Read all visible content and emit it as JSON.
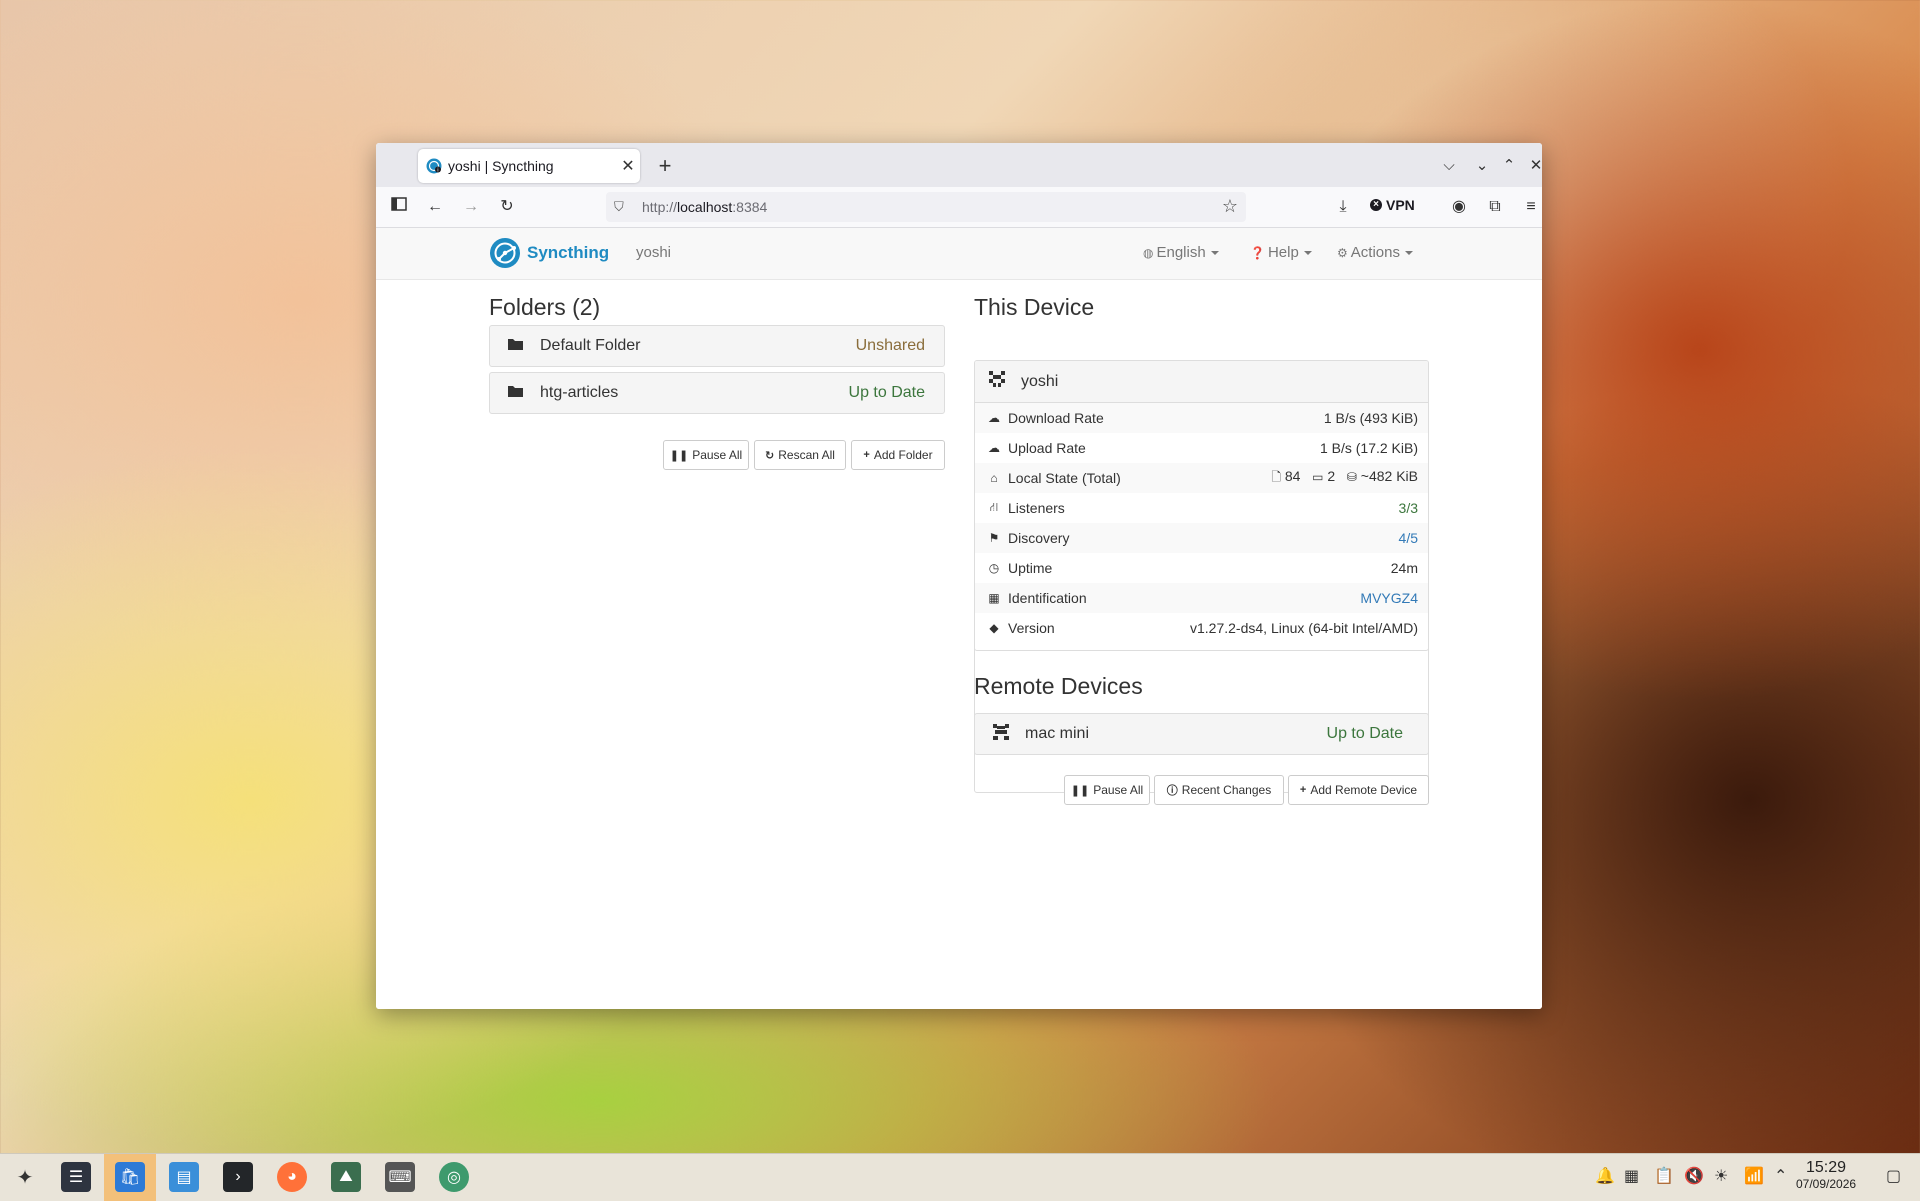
{
  "browser": {
    "tab_title": "yoshi | Syncthing",
    "tab_close": "✕",
    "new_tab": "+",
    "url_scheme": "http://",
    "url_host": "localhost",
    "url_port": ":8384",
    "vpn_label": "VPN"
  },
  "syncthing": {
    "brand": "Syncthing",
    "device_name": "yoshi",
    "menu": {
      "language": "English",
      "help": "Help",
      "actions": "Actions"
    },
    "folders": {
      "heading": "Folders (2)",
      "items": [
        {
          "name": "Default Folder",
          "status": "Unshared"
        },
        {
          "name": "htg-articles",
          "status": "Up to Date"
        }
      ],
      "buttons": {
        "pause_all": "Pause All",
        "rescan_all": "Rescan All",
        "add_folder": "Add Folder"
      }
    },
    "this_device": {
      "heading": "This Device",
      "name": "yoshi",
      "rows": [
        {
          "label": "Download Rate",
          "value": "1 B/s (493 KiB)"
        },
        {
          "label": "Upload Rate",
          "value": "1 B/s (17.2 KiB)"
        },
        {
          "label": "Local State (Total)",
          "files": "84",
          "dirs": "2",
          "size": "~482 KiB"
        },
        {
          "label": "Listeners",
          "value": "3/3"
        },
        {
          "label": "Discovery",
          "value": "4/5"
        },
        {
          "label": "Uptime",
          "value": "24m"
        },
        {
          "label": "Identification",
          "value": "MVYGZ4"
        },
        {
          "label": "Version",
          "value": "v1.27.2-ds4, Linux (64-bit Intel/AMD)"
        }
      ]
    },
    "remote_devices": {
      "heading": "Remote Devices",
      "items": [
        {
          "name": "mac mini",
          "status": "Up to Date"
        }
      ],
      "buttons": {
        "pause_all": "Pause All",
        "recent_changes": "Recent Changes",
        "add_remote_device": "Add Remote Device"
      }
    }
  },
  "taskbar": {
    "time": "15:29",
    "date": "07/09/2026"
  },
  "colors": {
    "brand": "#1f8bc2",
    "status_green": "#3c763d",
    "status_unshared": "#8a6d3b",
    "link_blue": "#337ab7"
  }
}
